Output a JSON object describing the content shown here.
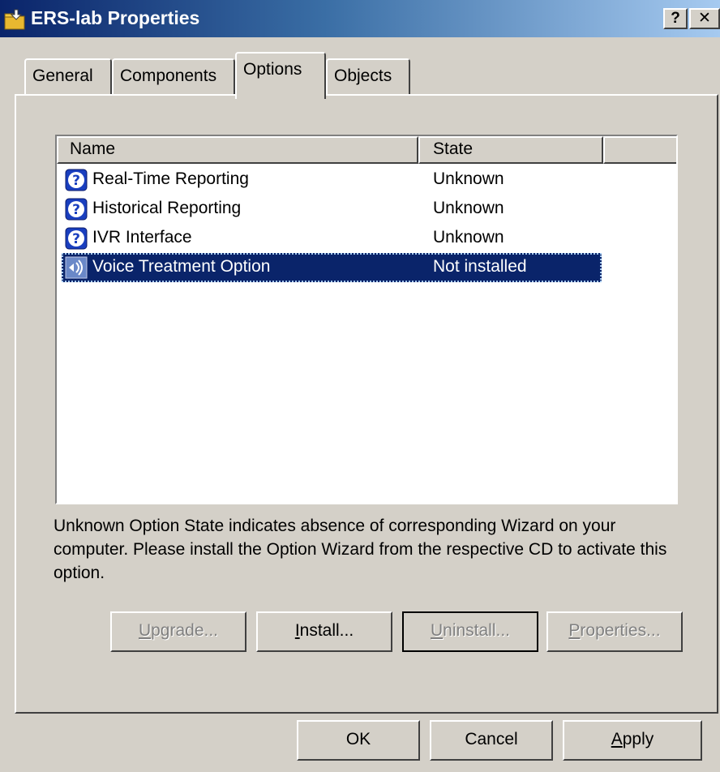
{
  "window": {
    "title": "ERS-lab Properties",
    "help_glyph": "?",
    "close_glyph": "✕"
  },
  "tabs": [
    {
      "label": "General"
    },
    {
      "label": "Components"
    },
    {
      "label": "Options",
      "selected": true
    },
    {
      "label": "Objects"
    }
  ],
  "list": {
    "columns": [
      "Name",
      "State"
    ],
    "rows": [
      {
        "name": "Real-Time Reporting",
        "state": "Unknown",
        "icon": "question-icon"
      },
      {
        "name": "Historical Reporting",
        "state": "Unknown",
        "icon": "question-icon"
      },
      {
        "name": "IVR Interface",
        "state": "Unknown",
        "icon": "question-icon"
      },
      {
        "name": "Voice Treatment Option",
        "state": "Not installed",
        "icon": "voice-option-icon",
        "selected": true
      }
    ]
  },
  "info_text": "Unknown Option State indicates absence of corresponding Wizard on your computer. Please install the Option Wizard from the respective CD to activate this option.",
  "actions": {
    "upgrade": {
      "pre": "",
      "key": "U",
      "post": "pgrade...",
      "enabled": false
    },
    "install": {
      "pre": "",
      "key": "I",
      "post": "nstall...",
      "enabled": true
    },
    "uninstall": {
      "pre": "",
      "key": "U",
      "post": "ninstall...",
      "enabled": false
    },
    "properties": {
      "pre": "",
      "key": "P",
      "post": "roperties...",
      "enabled": false
    }
  },
  "dialog": {
    "ok": "OK",
    "cancel": "Cancel",
    "apply": {
      "key": "A",
      "post": "pply"
    }
  },
  "colors": {
    "selection": "#0a246a",
    "face": "#d4d0c8"
  }
}
